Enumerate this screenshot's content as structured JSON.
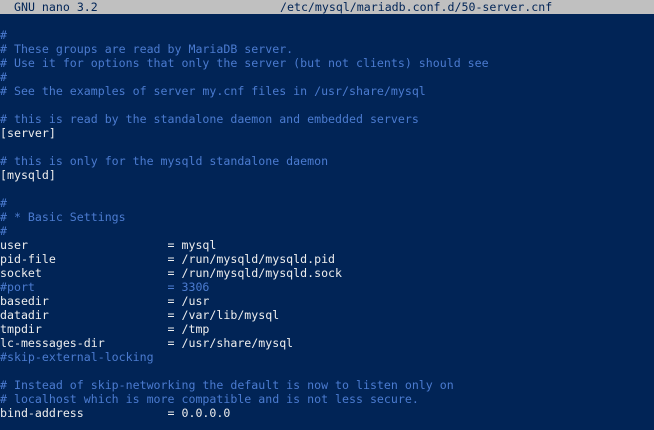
{
  "titlebar": {
    "app_name": "GNU nano 3.2",
    "file_path": "/etc/mysql/mariadb.conf.d/50-server.cnf"
  },
  "editor": {
    "lines": [
      {
        "text": "#",
        "type": "comment"
      },
      {
        "text": "# These groups are read by MariaDB server.",
        "type": "comment"
      },
      {
        "text": "# Use it for options that only the server (but not clients) should see",
        "type": "comment"
      },
      {
        "text": "#",
        "type": "comment"
      },
      {
        "text": "# See the examples of server my.cnf files in /usr/share/mysql",
        "type": "comment"
      },
      {
        "text": "",
        "type": "normal"
      },
      {
        "text": "# this is read by the standalone daemon and embedded servers",
        "type": "comment"
      },
      {
        "text": "[server]",
        "type": "normal"
      },
      {
        "text": "",
        "type": "normal"
      },
      {
        "text": "# this is only for the mysqld standalone daemon",
        "type": "comment"
      },
      {
        "text": "[mysqld]",
        "type": "normal"
      },
      {
        "text": "",
        "type": "normal"
      },
      {
        "text": "#",
        "type": "comment"
      },
      {
        "text": "# * Basic Settings",
        "type": "comment"
      },
      {
        "text": "#",
        "type": "comment"
      },
      {
        "text": "user                    = mysql",
        "type": "normal"
      },
      {
        "text": "pid-file                = /run/mysqld/mysqld.pid",
        "type": "normal"
      },
      {
        "text": "socket                  = /run/mysqld/mysqld.sock",
        "type": "normal"
      },
      {
        "text": "#port                   = 3306",
        "type": "comment"
      },
      {
        "text": "basedir                 = /usr",
        "type": "normal"
      },
      {
        "text": "datadir                 = /var/lib/mysql",
        "type": "normal"
      },
      {
        "text": "tmpdir                  = /tmp",
        "type": "normal"
      },
      {
        "text": "lc-messages-dir         = /usr/share/mysql",
        "type": "normal"
      },
      {
        "text": "#skip-external-locking",
        "type": "comment"
      },
      {
        "text": "",
        "type": "normal"
      },
      {
        "text": "# Instead of skip-networking the default is now to listen only on",
        "type": "comment"
      },
      {
        "text": "# localhost which is more compatible and is not less secure.",
        "type": "comment"
      },
      {
        "text": "bind-address            = 0.0.0.0",
        "type": "normal"
      }
    ]
  },
  "colors": {
    "background": "#012456",
    "titlebar_bg": "#c0c0c0",
    "text": "#eeeeee",
    "comment": "#4b7bd0"
  }
}
